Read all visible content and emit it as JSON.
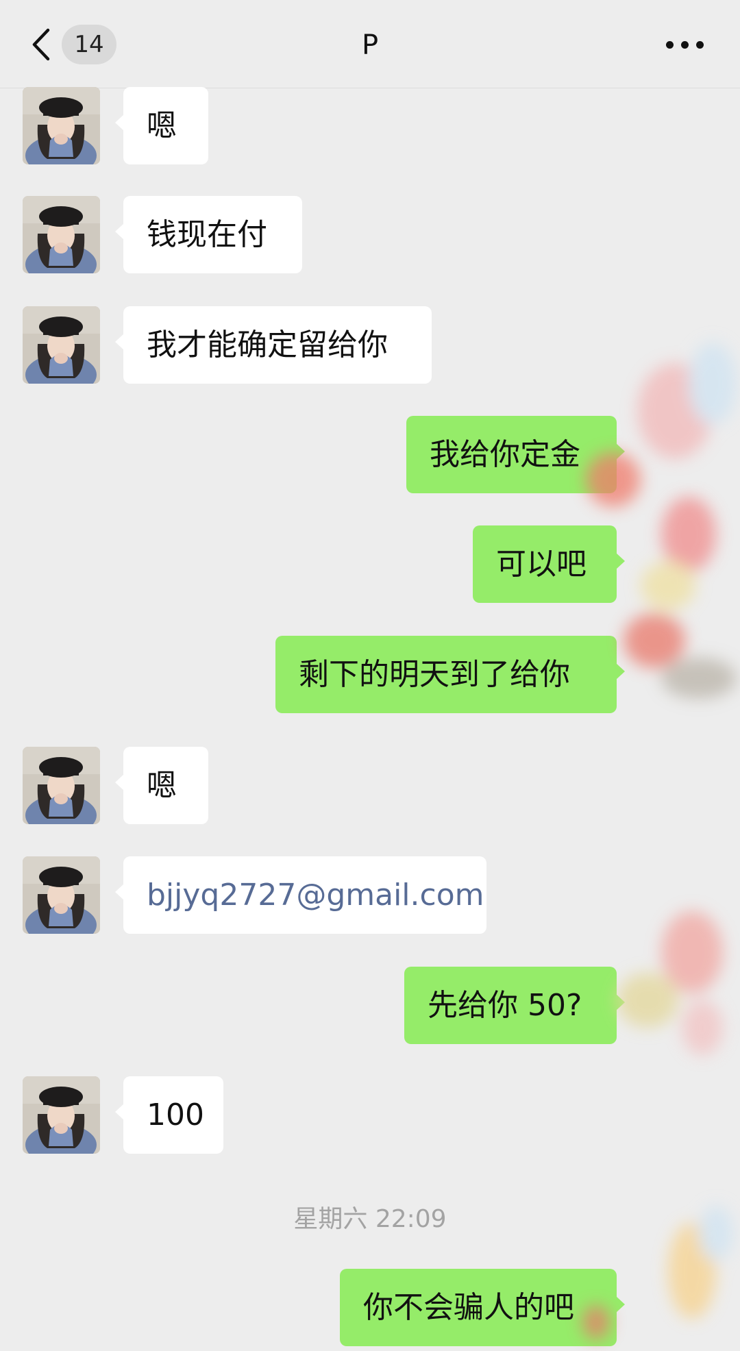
{
  "header": {
    "unread_count": "14",
    "title": "P"
  },
  "messages": [
    {
      "side": "left",
      "text": "嗯"
    },
    {
      "side": "left",
      "text": "钱现在付"
    },
    {
      "side": "left",
      "text": "我才能确定留给你"
    },
    {
      "side": "right",
      "text": "我给你定金"
    },
    {
      "side": "right",
      "text": "可以吧"
    },
    {
      "side": "right",
      "text": "剩下的明天到了给你"
    },
    {
      "side": "left",
      "text": "嗯"
    },
    {
      "side": "left",
      "text": "bjjyq2727@gmail.com"
    },
    {
      "side": "right",
      "text": "先给你 50?"
    },
    {
      "side": "left",
      "text": "100"
    },
    {
      "side": "right",
      "text": "你不会骗人的吧"
    }
  ],
  "timestamp": "星期六 22:09",
  "colors": {
    "background": "#ededed",
    "incoming_bubble": "#ffffff",
    "outgoing_bubble": "#95ec69",
    "link": "#576b95",
    "timestamp": "#a3a3a3"
  },
  "icons": {
    "back": "chevron-left-icon",
    "more": "more-dots-icon",
    "avatar": "contact-avatar"
  }
}
